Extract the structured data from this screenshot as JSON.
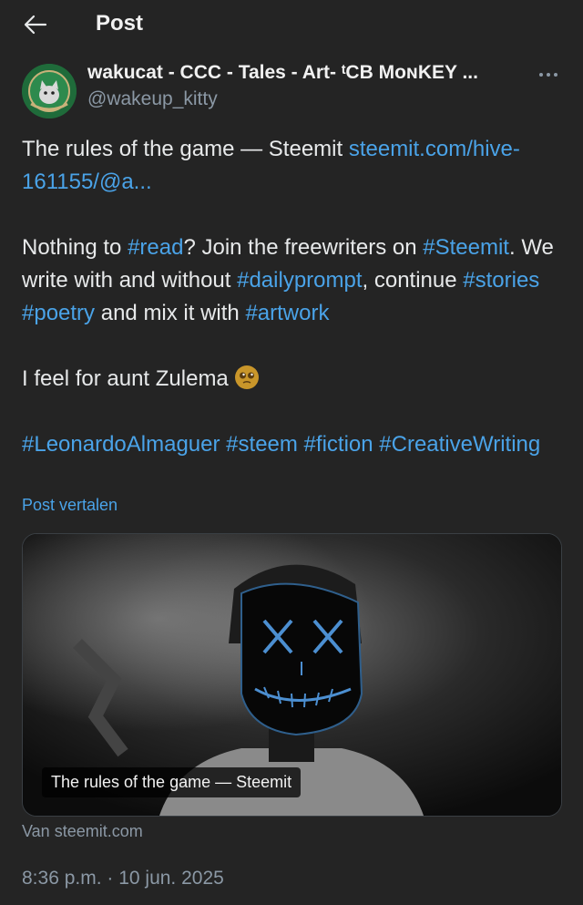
{
  "header": {
    "title": "Post"
  },
  "author": {
    "name": "wakucat - CCC - Tales - Art- ᵗCB MᴏɴKEY ...",
    "handle": "@wakeup_kitty"
  },
  "post": {
    "line1_text": "The rules of the game — Steemit ",
    "line1_link": "steemit.com/hive-",
    "line2_link": "161155/@a...",
    "p2": [
      {
        "t": "Nothing to "
      },
      {
        "l": "#read"
      },
      {
        "t": "? Join the freewriters on "
      },
      {
        "l": "#Steemit"
      },
      {
        "t": ". We write with and without "
      },
      {
        "l": "#dailyprompt"
      },
      {
        "t": ", continue "
      },
      {
        "l": "#stories"
      },
      {
        "t": " "
      },
      {
        "l": "#poetry"
      },
      {
        "t": " and mix it with "
      },
      {
        "l": "#artwork"
      }
    ],
    "p3": "I feel for aunt Zulema ",
    "p4": [
      {
        "l": "#LeonardoAlmaguer"
      },
      {
        "t": " "
      },
      {
        "l": "#steem"
      },
      {
        "t": " "
      },
      {
        "l": "#fiction"
      },
      {
        "t": " "
      },
      {
        "l": "#CreativeWriting"
      }
    ]
  },
  "translate_label": "Post vertalen",
  "link_card": {
    "caption": "The rules of the game — Steemit",
    "source": "Van steemit.com"
  },
  "timestamp": "8:36 p.m. · 10 jun. 2025",
  "colors": {
    "link": "#4aa3e8",
    "background": "#242424",
    "muted": "#8b98a5"
  },
  "icons": [
    "back-arrow-icon",
    "more-options-icon",
    "pleading-face-emoji-icon"
  ]
}
